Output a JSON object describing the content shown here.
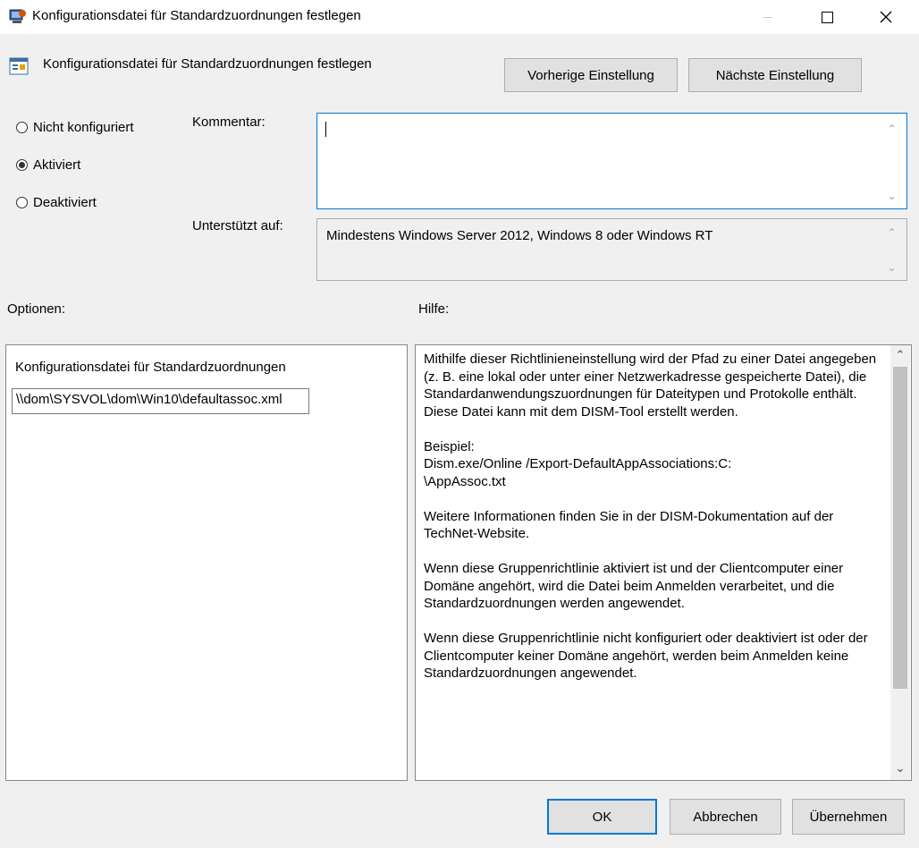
{
  "window": {
    "title": "Konfigurationsdatei für Standardzuordnungen festlegen",
    "controls": {
      "minimize": "—",
      "maximize": "☐",
      "close": "✕"
    }
  },
  "header": {
    "title": "Konfigurationsdatei für Standardzuordnungen festlegen",
    "prev_button": "Vorherige Einstellung",
    "next_button": "Nächste Einstellung"
  },
  "state": {
    "options": [
      "Nicht konfiguriert",
      "Aktiviert",
      "Deaktiviert"
    ],
    "selected": "Aktiviert"
  },
  "comment": {
    "label": "Kommentar:",
    "value": ""
  },
  "supported": {
    "label": "Unterstützt auf:",
    "value": "Mindestens Windows Server 2012, Windows 8 oder Windows RT"
  },
  "options_section": {
    "label": "Optionen:",
    "field_label": "Konfigurationsdatei für Standardzuordnungen",
    "field_value": "\\\\dom\\SYSVOL\\dom\\Win10\\defaultassoc.xml"
  },
  "help_section": {
    "label": "Hilfe:",
    "paragraphs": [
      "Mithilfe dieser Richtlinieneinstellung wird der Pfad zu einer Datei angegeben (z. B. eine lokal oder unter einer Netzwerkadresse gespeicherte Datei), die Standardanwendungszuordnungen für Dateitypen und Protokolle enthält. Diese Datei kann mit dem DISM-Tool erstellt werden.",
      "Beispiel:\nDism.exe/Online /Export-DefaultAppAssociations:C:\n\\AppAssoc.txt",
      "Weitere Informationen finden Sie in der DISM-Dokumentation auf der TechNet-Website.",
      "Wenn diese Gruppenrichtlinie aktiviert ist und der Clientcomputer einer Domäne angehört, wird die Datei beim Anmelden verarbeitet, und die Standardzuordnungen werden angewendet.",
      "Wenn diese Gruppenrichtlinie nicht konfiguriert oder deaktiviert ist oder der Clientcomputer keiner Domäne angehört, werden beim Anmelden keine Standardzuordnungen angewendet."
    ]
  },
  "footer": {
    "ok": "OK",
    "cancel": "Abbrechen",
    "apply": "Übernehmen"
  },
  "icons": {
    "window_icon": "policy-window-icon",
    "header_icon": "policy-setting-icon",
    "scroll_up": "chevron-up-icon",
    "scroll_down": "chevron-down-icon"
  },
  "colors": {
    "accent": "#0078d7",
    "background": "#f0f0f0",
    "titlebar": "#ffffff"
  }
}
